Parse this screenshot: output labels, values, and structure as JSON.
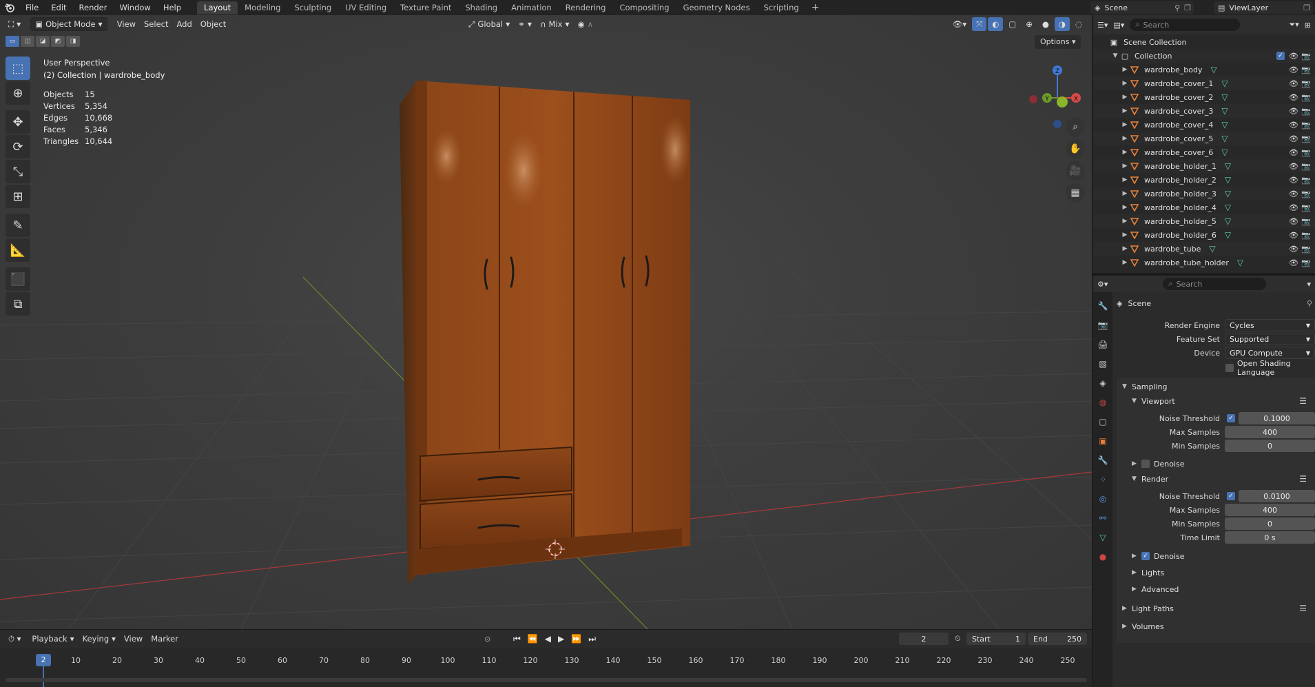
{
  "topbar": {
    "menus": [
      "File",
      "Edit",
      "Render",
      "Window",
      "Help"
    ],
    "workspaces": [
      "Layout",
      "Modeling",
      "Sculpting",
      "UV Editing",
      "Texture Paint",
      "Shading",
      "Animation",
      "Rendering",
      "Compositing",
      "Geometry Nodes",
      "Scripting"
    ],
    "active_workspace": "Layout",
    "scene": "Scene",
    "view_layer": "ViewLayer"
  },
  "viewport": {
    "mode": "Object Mode",
    "menus": [
      "View",
      "Select",
      "Add",
      "Object"
    ],
    "transform_orientation": "Global",
    "snap_mode": "Mix",
    "options_label": "Options",
    "perspective_label": "User Perspective",
    "collection_label": "(2) Collection | wardrobe_body",
    "stats": [
      {
        "label": "Objects",
        "value": "15"
      },
      {
        "label": "Vertices",
        "value": "5,354"
      },
      {
        "label": "Edges",
        "value": "10,668"
      },
      {
        "label": "Faces",
        "value": "5,346"
      },
      {
        "label": "Triangles",
        "value": "10,644"
      }
    ],
    "gizmo_axes": {
      "x": "X",
      "y": "Y",
      "z": "Z"
    }
  },
  "timeline": {
    "menus": [
      "Playback",
      "Keying",
      "View",
      "Marker"
    ],
    "current_frame": "2",
    "start_label": "Start",
    "start_value": "1",
    "end_label": "End",
    "end_value": "250",
    "ticks": [
      "10",
      "20",
      "30",
      "40",
      "50",
      "60",
      "70",
      "80",
      "90",
      "100",
      "110",
      "120",
      "130",
      "140",
      "150",
      "160",
      "170",
      "180",
      "190",
      "200",
      "210",
      "220",
      "230",
      "240",
      "250"
    ],
    "playhead": "2"
  },
  "outliner": {
    "search_placeholder": "Search",
    "root": "Scene Collection",
    "collection": "Collection",
    "objects": [
      "wardrobe_body",
      "wardrobe_cover_1",
      "wardrobe_cover_2",
      "wardrobe_cover_3",
      "wardrobe_cover_4",
      "wardrobe_cover_5",
      "wardrobe_cover_6",
      "wardrobe_holder_1",
      "wardrobe_holder_2",
      "wardrobe_holder_3",
      "wardrobe_holder_4",
      "wardrobe_holder_5",
      "wardrobe_holder_6",
      "wardrobe_tube",
      "wardrobe_tube_holder"
    ]
  },
  "properties": {
    "search_placeholder": "Search",
    "context": "Scene",
    "render_engine_label": "Render Engine",
    "render_engine": "Cycles",
    "feature_set_label": "Feature Set",
    "feature_set": "Supported",
    "device_label": "Device",
    "device": "GPU Compute",
    "osl_label": "Open Shading Language",
    "sampling_label": "Sampling",
    "viewport_label": "Viewport",
    "noise_threshold_label": "Noise Threshold",
    "vp_noise_threshold": "0.1000",
    "max_samples_label": "Max Samples",
    "vp_max_samples": "400",
    "min_samples_label": "Min Samples",
    "vp_min_samples": "0",
    "denoise_label": "Denoise",
    "render_label": "Render",
    "r_noise_threshold": "0.0100",
    "r_max_samples": "400",
    "r_min_samples": "0",
    "time_limit_label": "Time Limit",
    "r_time_limit": "0 s",
    "lights_label": "Lights",
    "advanced_label": "Advanced",
    "light_paths_label": "Light Paths",
    "volumes_label": "Volumes"
  },
  "colors": {
    "accent": "#4772b3",
    "wood": "#7a3a14",
    "mesh_icon": "#5fd4a8",
    "object_icon": "#e8803a"
  }
}
